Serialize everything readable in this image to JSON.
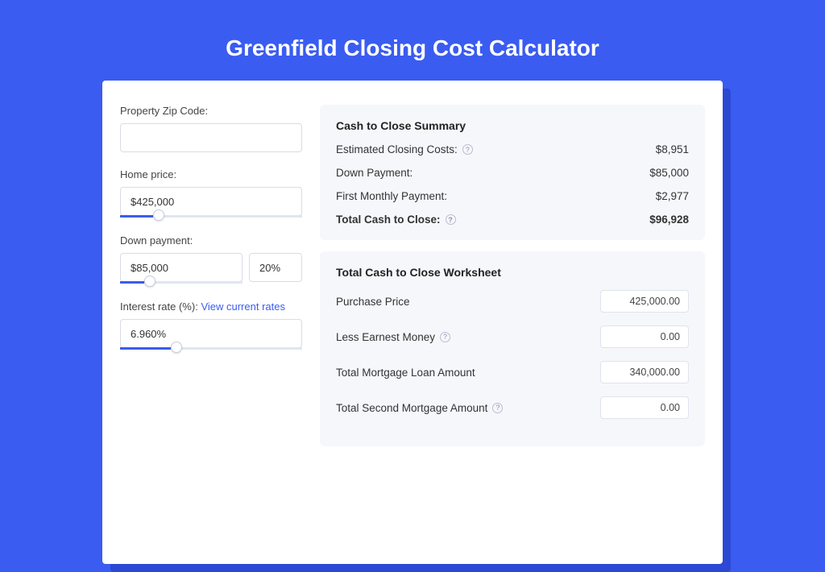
{
  "page": {
    "title": "Greenfield Closing Cost Calculator"
  },
  "form": {
    "zip": {
      "label": "Property Zip Code:",
      "value": ""
    },
    "home_price": {
      "label": "Home price:",
      "value": "$425,000",
      "slider_pct": 18
    },
    "down_payment": {
      "label": "Down payment:",
      "value": "$85,000",
      "pct": "20%",
      "slider_pct": 20
    },
    "interest_rate": {
      "label": "Interest rate (%):",
      "link": "View current rates",
      "value": "6.960%",
      "slider_pct": 28
    }
  },
  "summary": {
    "title": "Cash to Close Summary",
    "rows": [
      {
        "label": "Estimated Closing Costs:",
        "help": true,
        "value": "$8,951",
        "bold": false
      },
      {
        "label": "Down Payment:",
        "help": false,
        "value": "$85,000",
        "bold": false
      },
      {
        "label": "First Monthly Payment:",
        "help": false,
        "value": "$2,977",
        "bold": false
      },
      {
        "label": "Total Cash to Close:",
        "help": true,
        "value": "$96,928",
        "bold": true
      }
    ]
  },
  "worksheet": {
    "title": "Total Cash to Close Worksheet",
    "rows": [
      {
        "label": "Purchase Price",
        "help": false,
        "value": "425,000.00"
      },
      {
        "label": "Less Earnest Money",
        "help": true,
        "value": "0.00"
      },
      {
        "label": "Total Mortgage Loan Amount",
        "help": false,
        "value": "340,000.00"
      },
      {
        "label": "Total Second Mortgage Amount",
        "help": true,
        "value": "0.00"
      }
    ]
  }
}
